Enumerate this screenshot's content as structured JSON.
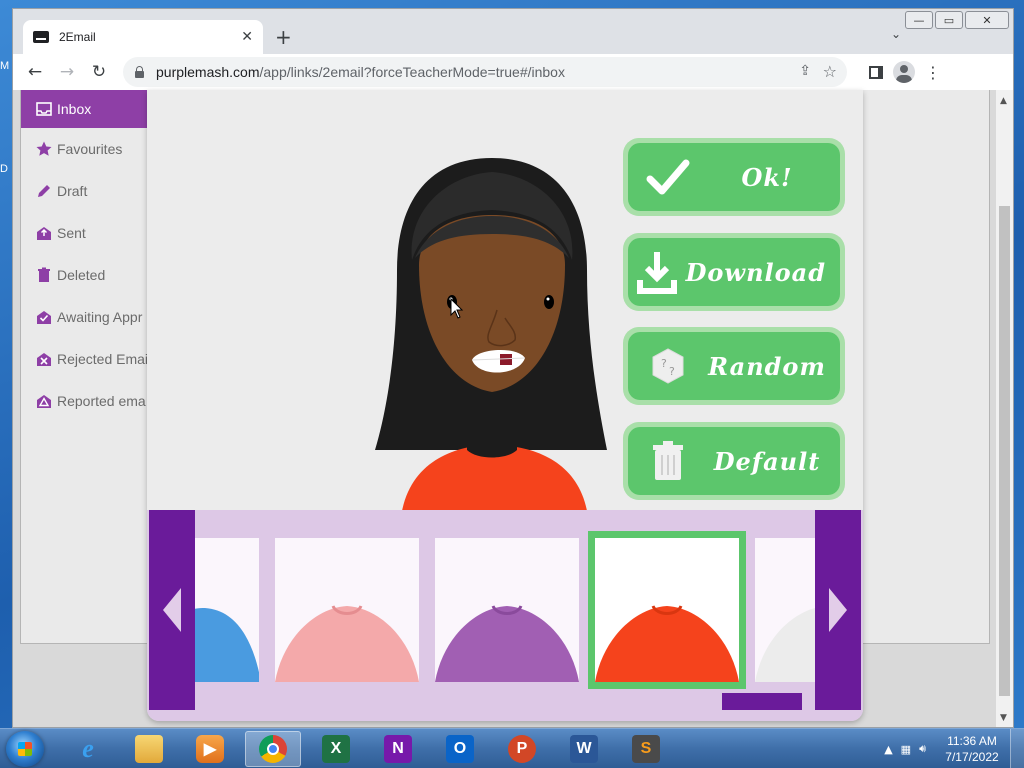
{
  "browser": {
    "tab_title": "2Email",
    "url_host": "purplemash.com",
    "url_path": "/app/links/2email?forceTeacherMode=true#/inbox",
    "caption": {
      "minimize": "—",
      "restore": "▭",
      "close": "✕"
    }
  },
  "desktop_peek": [
    "M",
    "D"
  ],
  "sidebar": {
    "items": [
      {
        "label": "Inbox",
        "icon": "inbox-icon",
        "active": true
      },
      {
        "label": "Favourites",
        "icon": "star-icon"
      },
      {
        "label": "Draft",
        "icon": "pencil-icon"
      },
      {
        "label": "Sent",
        "icon": "sent-icon"
      },
      {
        "label": "Deleted",
        "icon": "trash-icon"
      },
      {
        "label": "Awaiting Appr",
        "icon": "awaiting-icon"
      },
      {
        "label": "Rejected Emai",
        "icon": "rejected-icon"
      },
      {
        "label": "Reported ema",
        "icon": "reported-icon"
      }
    ]
  },
  "avatar_editor": {
    "buttons": [
      {
        "label": "Ok!",
        "icon": "checkmark-icon"
      },
      {
        "label": "Download",
        "icon": "download-icon"
      },
      {
        "label": "Random",
        "icon": "dice-icon"
      },
      {
        "label": "Default",
        "icon": "trash-icon"
      }
    ],
    "swatches": [
      {
        "color": "#4a9be0",
        "selected": false
      },
      {
        "color": "#f4a9aa",
        "selected": false
      },
      {
        "color": "#a15fb3",
        "selected": false
      },
      {
        "color": "#f5431c",
        "selected": true
      },
      {
        "color": "#f2f2f2",
        "selected": false
      }
    ],
    "colors": {
      "accent_purple": "#6a1b9a",
      "button_green": "#5cc66c",
      "shirt": "#f5431c"
    }
  },
  "taskbar": {
    "apps": [
      "internet-explorer",
      "file-explorer",
      "media-player",
      "chrome",
      "excel",
      "onenote",
      "outlook",
      "powerpoint",
      "word",
      "sublime-text"
    ],
    "app_letters": {
      "excel": "X",
      "onenote": "N",
      "outlook": "O",
      "powerpoint": "P",
      "word": "W",
      "sublime": "S"
    },
    "time": "11:36 AM",
    "date": "7/17/2022"
  }
}
